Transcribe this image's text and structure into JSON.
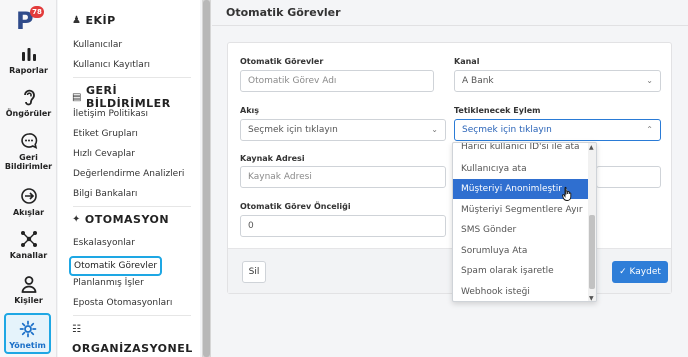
{
  "app": {
    "logo_letter": "P",
    "notification_count": "78"
  },
  "rail": [
    {
      "name": "reports",
      "label": "Raporlar",
      "icon": "bar-chart-icon"
    },
    {
      "name": "predictors",
      "label": "Öngörüler",
      "icon": "ear-icon"
    },
    {
      "name": "feedback",
      "label": "Geri Bildirimler",
      "icon": "chat-bubble-icon"
    },
    {
      "name": "flows",
      "label": "Akışlar",
      "icon": "flow-icon"
    },
    {
      "name": "channels",
      "label": "Kanallar",
      "icon": "network-icon"
    },
    {
      "name": "people",
      "label": "Kişiler",
      "icon": "person-icon"
    },
    {
      "name": "admin",
      "label": "Yönetim",
      "icon": "gear-icon",
      "active": true
    }
  ],
  "menu": {
    "team_title": "EKİP",
    "team_items": [
      "Kullanıcılar",
      "Kullanıcı Kayıtları"
    ],
    "feedback_title": "GERİ BİLDİRİMLER",
    "feedback_items": [
      "İletişim Politikası",
      "Etiket Grupları",
      "Hızlı Cevaplar",
      "Değerlendirme Analizleri",
      "Bilgi Bankaları"
    ],
    "automation_title": "OTOMASYON",
    "automation_items": [
      "Eskalasyonlar",
      "Otomatik Görevler",
      "Planlanmış İşler",
      "Eposta Otomasyonları"
    ],
    "org_title": "ORGANİZASYONEL YAPI"
  },
  "page": {
    "title": "Otomatik Görevler"
  },
  "form": {
    "task_label": "Otomatik Görevler",
    "task_placeholder": "Otomatik Görev Adı",
    "channel_label": "Kanal",
    "channel_value": "A Bank",
    "flow_label": "Akış",
    "flow_value": "Seçmek için tıklayın",
    "action_label": "Tetiklenecek Eylem",
    "action_value": "Seçmek için tıklayın",
    "source_label": "Kaynak Adresi",
    "source_placeholder": "Kaynak Adresi",
    "priority_label": "Otomatik Görev Önceliği",
    "priority_value": "0",
    "delete_label": "Sil",
    "save_label": "Kaydet"
  },
  "dropdown": {
    "options": [
      "Harici kullanıcı ID'si ile ata",
      "Kullanıcıya ata",
      "Müşteriyi Anonimleştir",
      "Müşteriyi Segmentlere Ayır",
      "SMS Gönder",
      "Sorumluya Ata",
      "Spam olarak işaretle",
      "Webhook isteği"
    ],
    "highlighted_index": 2
  },
  "colors": {
    "accent": "#2f7ed8",
    "highlight_border": "#1ea7e4",
    "badge": "#e23b3b"
  }
}
